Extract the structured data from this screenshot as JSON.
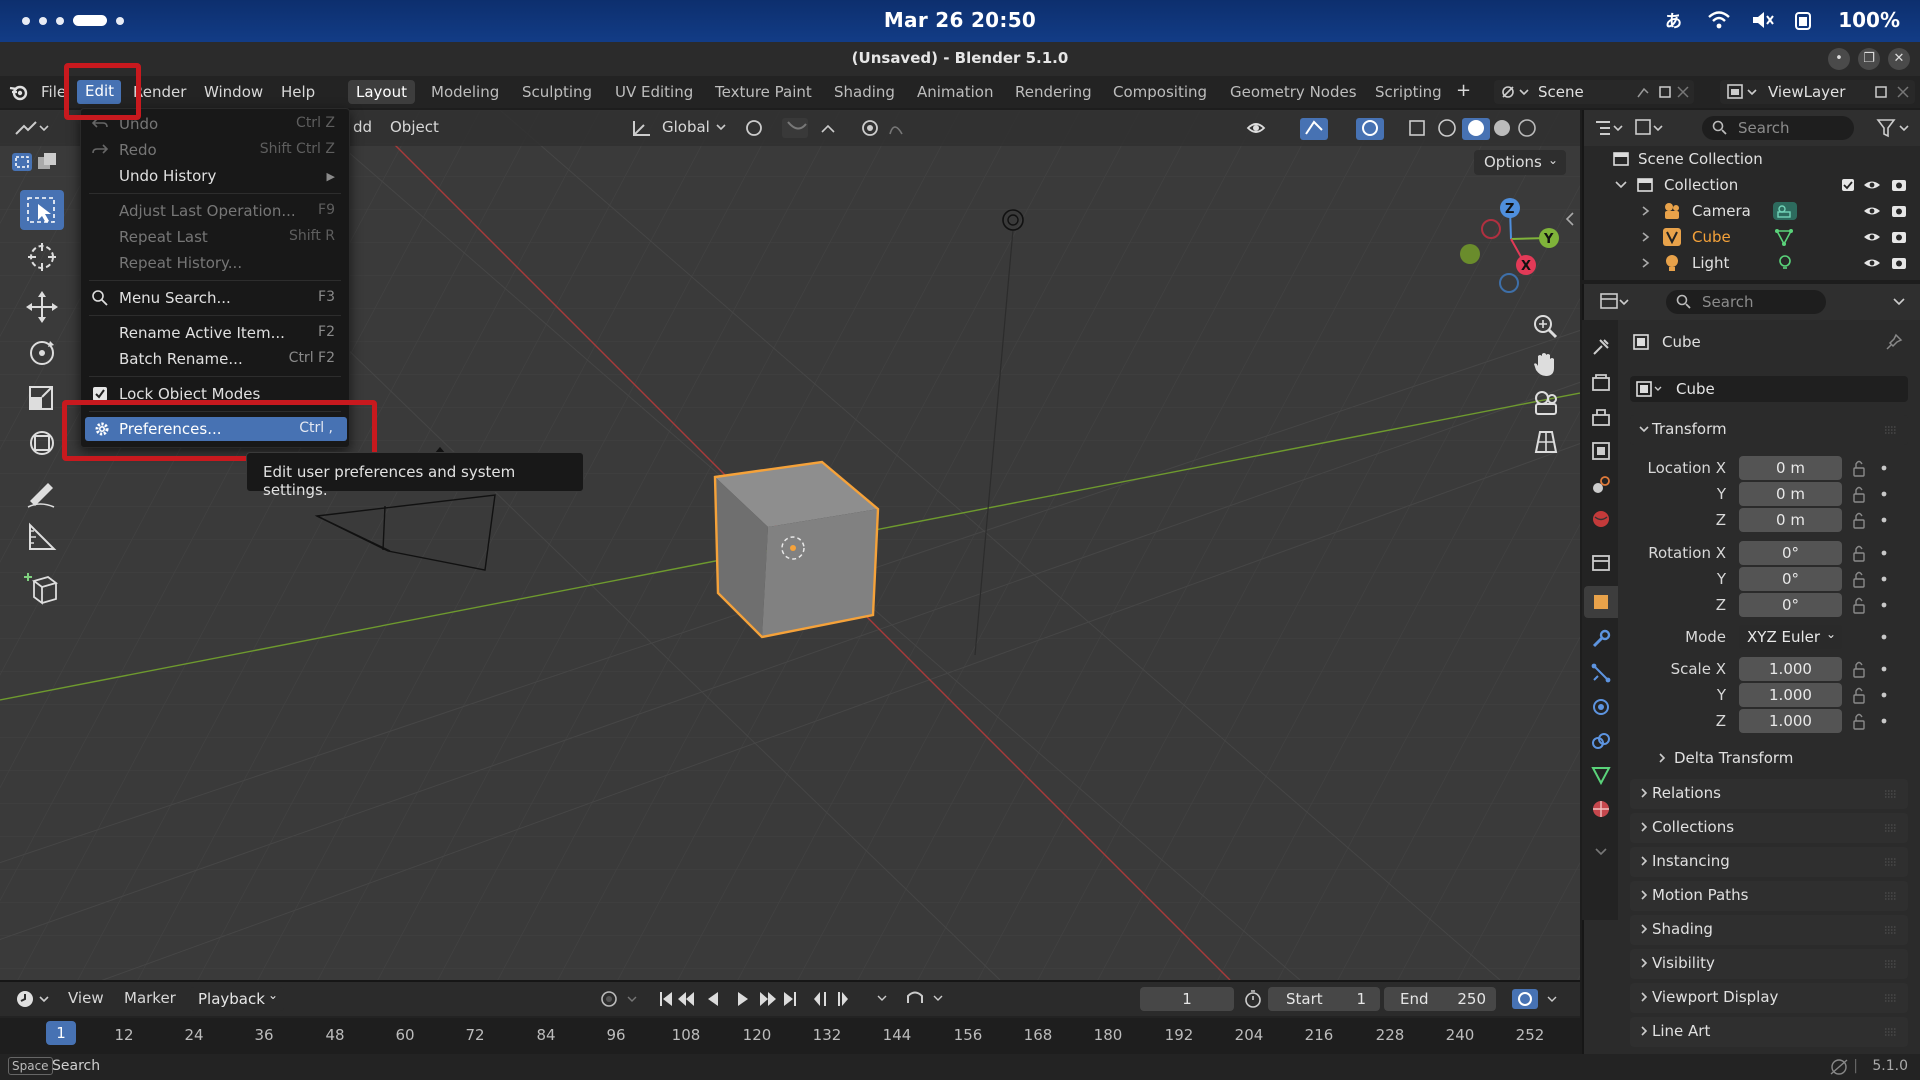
{
  "mac": {
    "date": "Mar 26  20:50",
    "battery": "100%"
  },
  "window": {
    "title": "(Unsaved) - Blender 5.1.0"
  },
  "menubar": {
    "file": "File",
    "edit": "Edit",
    "render": "Render",
    "window": "Window",
    "help": "Help"
  },
  "workspaces": [
    "Layout",
    "Modeling",
    "Sculpting",
    "UV Editing",
    "Texture Paint",
    "Shading",
    "Animation",
    "Rendering",
    "Compositing",
    "Geometry Nodes",
    "Scripting"
  ],
  "scene": {
    "name": "Scene",
    "view_layer": "ViewLayer"
  },
  "viewport": {
    "add": "dd",
    "object": "Object",
    "orientation": "Global",
    "options": "Options"
  },
  "edit_menu": {
    "items": [
      {
        "label": "Undo",
        "shortcut": "Ctrl Z",
        "disabled": true
      },
      {
        "label": "Redo",
        "shortcut": "Shift Ctrl Z",
        "disabled": true
      },
      {
        "label": "Undo History",
        "shortcut": "",
        "disabled": false
      },
      {
        "label": "Adjust Last Operation...",
        "shortcut": "F9",
        "disabled": true
      },
      {
        "label": "Repeat Last",
        "shortcut": "Shift R",
        "disabled": true
      },
      {
        "label": "Repeat History...",
        "shortcut": "",
        "disabled": true
      },
      {
        "label": "Menu Search...",
        "shortcut": "F3",
        "disabled": false
      },
      {
        "label": "Rename Active Item...",
        "shortcut": "F2",
        "disabled": false
      },
      {
        "label": "Batch Rename...",
        "shortcut": "Ctrl F2",
        "disabled": false
      },
      {
        "label": "Lock Object Modes",
        "shortcut": "",
        "disabled": false
      },
      {
        "label": "Preferences...",
        "shortcut": "Ctrl ,",
        "disabled": false
      }
    ],
    "tooltip": "Edit user preferences and system settings."
  },
  "outliner": {
    "search_placeholder": "Search",
    "scene_collection": "Scene Collection",
    "collection": "Collection",
    "items": [
      "Camera",
      "Cube",
      "Light"
    ]
  },
  "properties": {
    "search_placeholder": "Search",
    "object_name": "Cube",
    "data_name": "Cube",
    "transform_title": "Transform",
    "location_label": "Location X",
    "rotation_label": "Rotation X",
    "scale_label": "Scale X",
    "y_label": "Y",
    "z_label": "Z",
    "mode_label": "Mode",
    "location": [
      "0 m",
      "0 m",
      "0 m"
    ],
    "rotation": [
      "0°",
      "0°",
      "0°"
    ],
    "mode": "XYZ Euler",
    "scale": [
      "1.000",
      "1.000",
      "1.000"
    ],
    "delta_transform": "Delta Transform",
    "panels": [
      "Relations",
      "Collections",
      "Instancing",
      "Motion Paths",
      "Shading",
      "Visibility",
      "Viewport Display",
      "Line Art"
    ]
  },
  "timeline": {
    "view": "View",
    "marker": "Marker",
    "playback": "Playback",
    "current_frame": "1",
    "start_label": "Start",
    "start": "1",
    "end_label": "End",
    "end": "250",
    "ruler": [
      "12",
      "24",
      "36",
      "48",
      "60",
      "72",
      "84",
      "96",
      "108",
      "120",
      "132",
      "144",
      "156",
      "168",
      "180",
      "192",
      "204",
      "216",
      "228",
      "240",
      "252"
    ],
    "ruler_current": "1"
  },
  "status": {
    "key": "Space",
    "hint": "Search",
    "version": "5.1.0"
  },
  "colors": {
    "accent": "#4772b3",
    "highlight_box": "#c8191e",
    "selected_orange": "#f5a23a"
  }
}
